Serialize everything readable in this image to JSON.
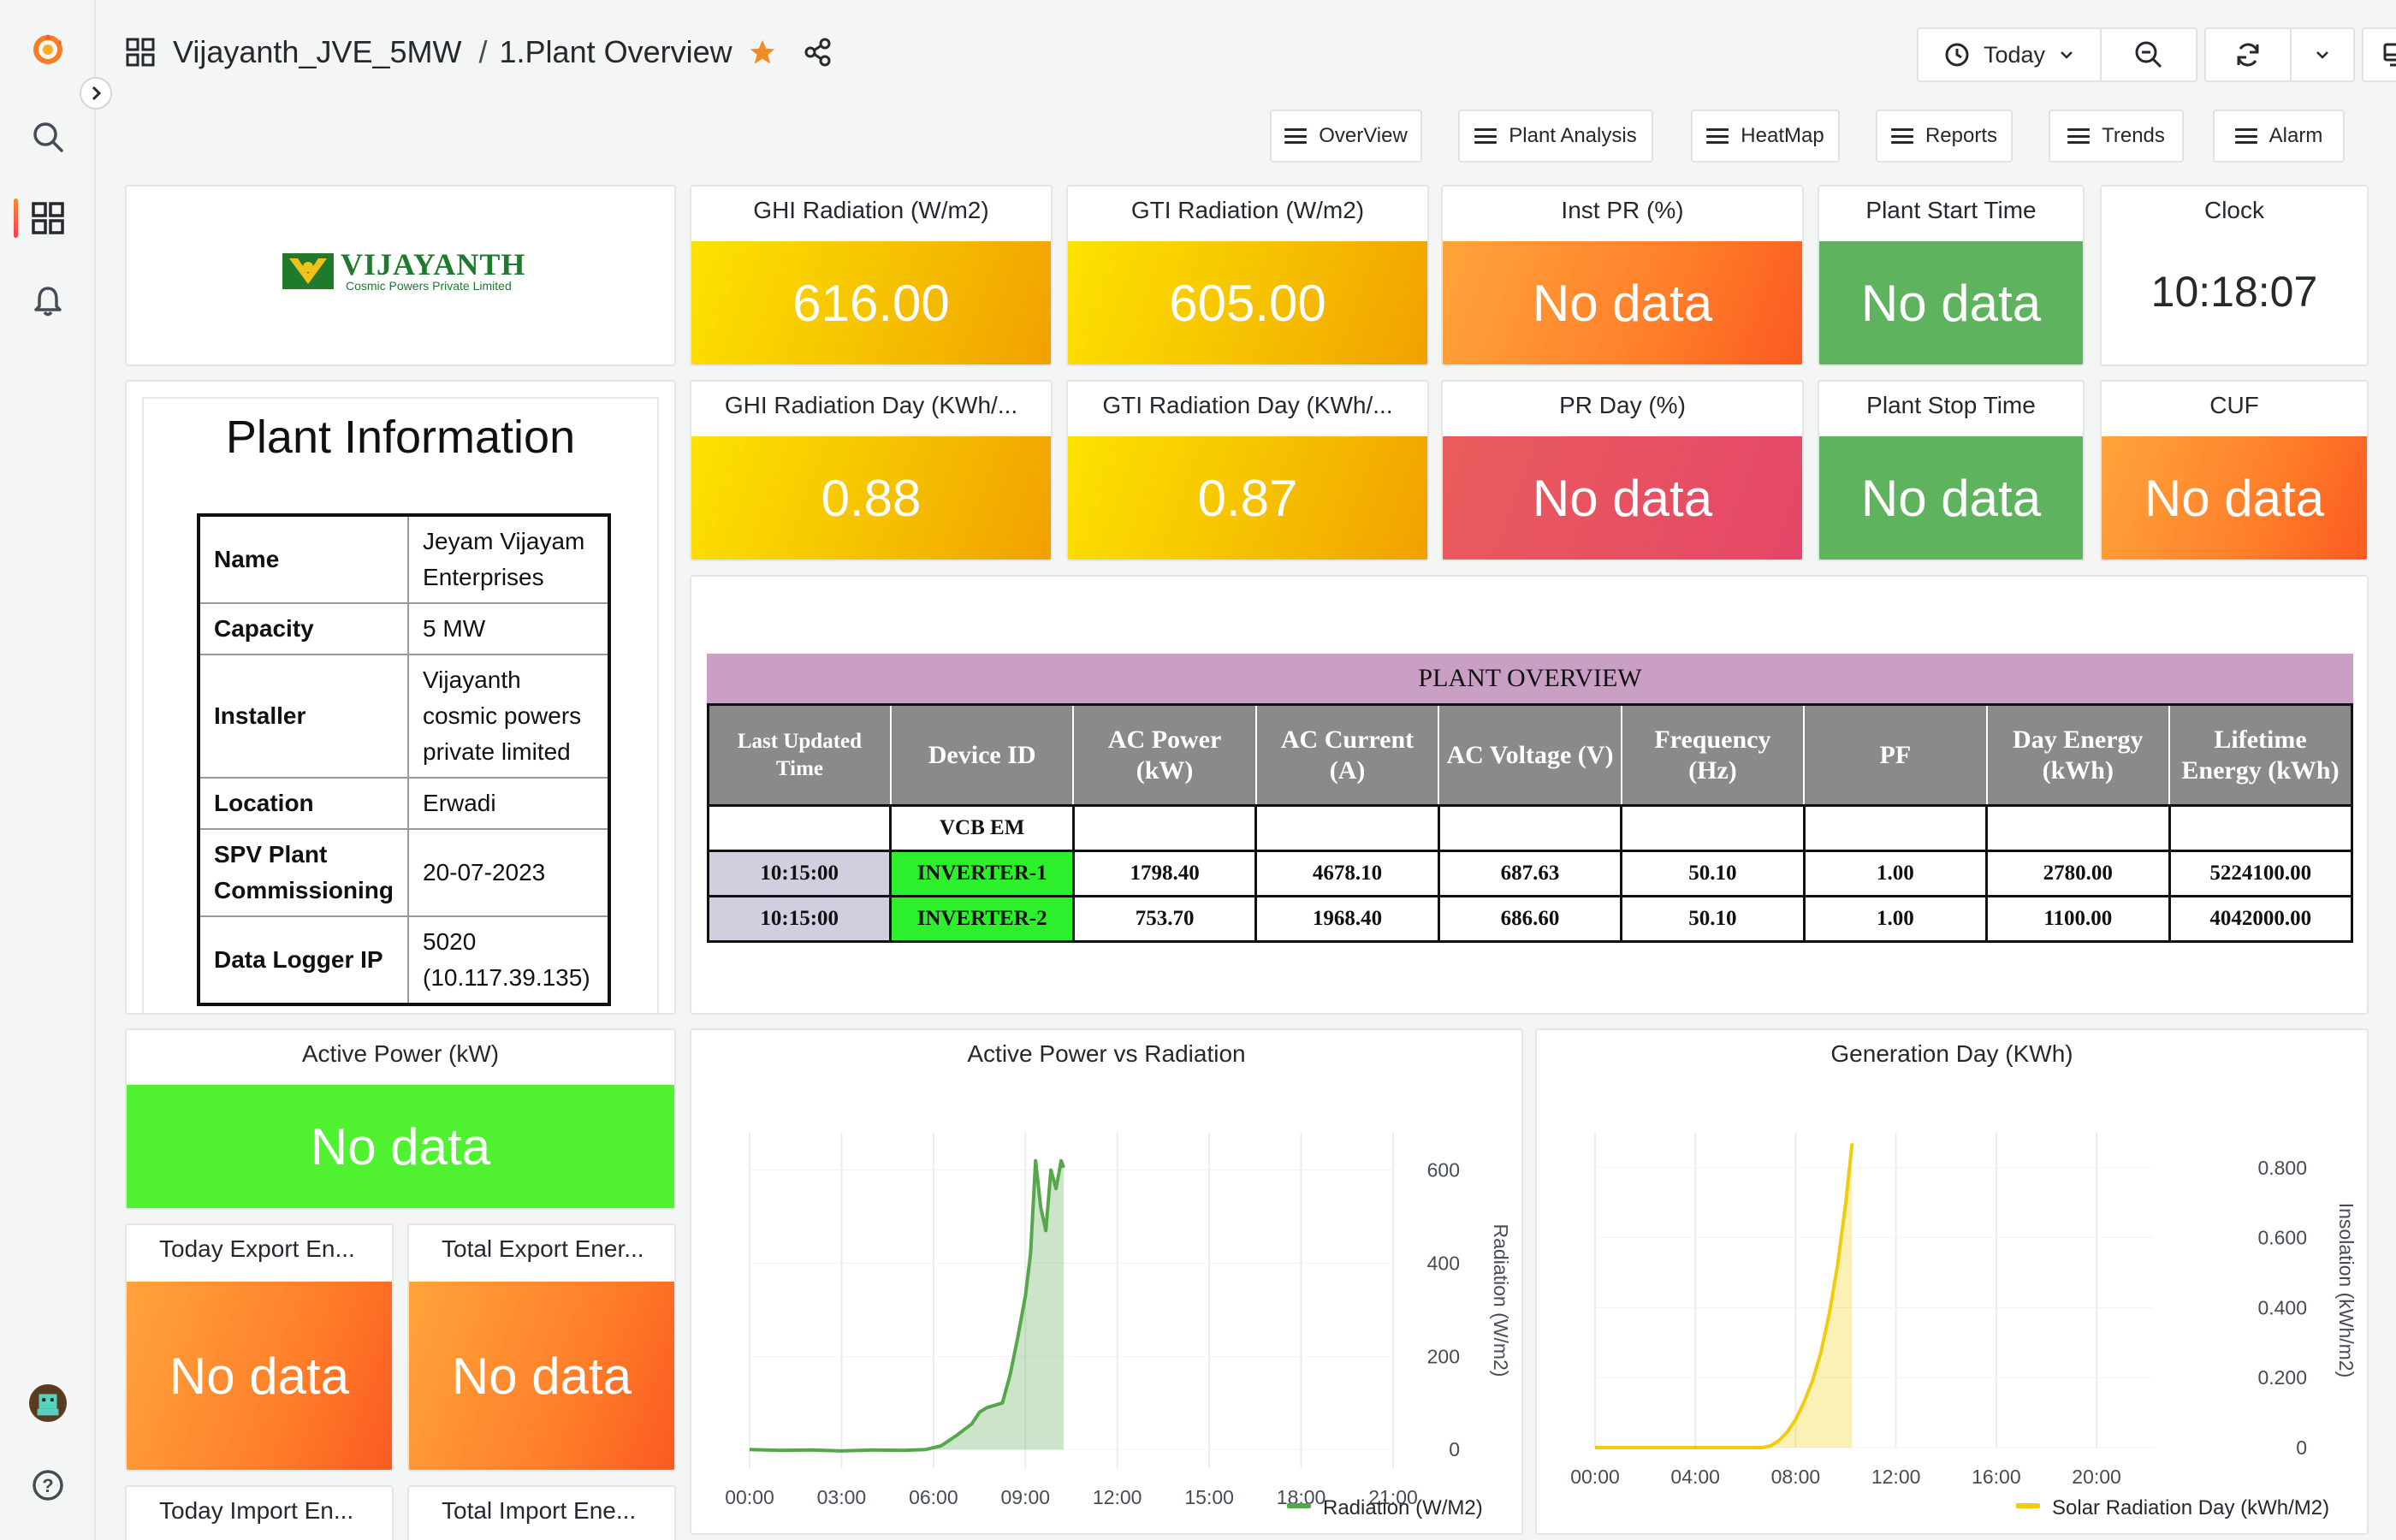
{
  "breadcrumb": {
    "folder": "Vijayanth_JVE_5MW",
    "separator": "/",
    "dashboard": "1.Plant Overview"
  },
  "time_picker": {
    "label": "Today"
  },
  "nav": [
    "OverView",
    "Plant Analysis",
    "HeatMap",
    "Reports",
    "Trends",
    "Alarm"
  ],
  "logo": {
    "name": "VIJAYANTH",
    "sub": "Cosmic Powers Private Limited"
  },
  "stats_row1": [
    {
      "title": "GHI Radiation (W/m2)",
      "value": "616.00",
      "color": "#f5c000"
    },
    {
      "title": "GTI Radiation (W/m2)",
      "value": "605.00",
      "color": "#f5c000"
    },
    {
      "title": "Inst PR (%)",
      "value": "No data",
      "color": "#ff7f2a"
    },
    {
      "title": "Plant Start Time",
      "value": "No data",
      "color": "#5fb35f"
    }
  ],
  "clock": {
    "title": "Clock",
    "value": "10:18:07"
  },
  "stats_row2": [
    {
      "title": "GHI Radiation Day (KWh/...",
      "value": "0.88",
      "color": "#f5c000"
    },
    {
      "title": "GTI Radiation Day (KWh/...",
      "value": "0.87",
      "color": "#f5c000"
    },
    {
      "title": "PR Day (%)",
      "value": "No data",
      "color": "#e44768"
    },
    {
      "title": "Plant Stop Time",
      "value": "No data",
      "color": "#5fb35f"
    },
    {
      "title": "CUF",
      "value": "No data",
      "color": "#ff7f2a"
    }
  ],
  "plant_info": {
    "title": "Plant Information",
    "rows": [
      {
        "k": "Name",
        "v": "Jeyam Vijayam Enterprises"
      },
      {
        "k": "Capacity",
        "v": "5 MW"
      },
      {
        "k": "Installer",
        "v": "Vijayanth cosmic powers private limited"
      },
      {
        "k": "Location",
        "v": "Erwadi"
      },
      {
        "k": "SPV Plant Commissioning",
        "v": "20-07-2023"
      },
      {
        "k": "Data Logger IP",
        "v": "5020 (10.117.39.135)"
      }
    ]
  },
  "plant_overview": {
    "title": "PLANT OVERVIEW",
    "headers": [
      "Last Updated Time",
      "Device ID",
      "AC Power (kW)",
      "AC Current (A)",
      "AC Voltage (V)",
      "Frequency (Hz)",
      "PF",
      "Day Energy (kWh)",
      "Lifetime Energy (kWh)"
    ],
    "group_label": "VCB EM",
    "rows": [
      [
        "10:15:00",
        "INVERTER-1",
        "1798.40",
        "4678.10",
        "687.63",
        "50.10",
        "1.00",
        "2780.00",
        "5224100.00"
      ],
      [
        "10:15:00",
        "INVERTER-2",
        "753.70",
        "1968.40",
        "686.60",
        "50.10",
        "1.00",
        "1100.00",
        "4042000.00"
      ]
    ]
  },
  "active_power": {
    "title": "Active Power (kW)",
    "value": "No data",
    "color": "#4ff131"
  },
  "energy_tiles": [
    {
      "title": "Today Export En...",
      "value": "No data",
      "color": "#ff7f2a"
    },
    {
      "title": "Total Export Ener...",
      "value": "No data",
      "color": "#ff7f2a"
    }
  ],
  "energy_tiles2": [
    {
      "title": "Today Import En..."
    },
    {
      "title": "Total Import Ene..."
    }
  ],
  "chart_data": [
    {
      "type": "area",
      "title": "Active Power vs Radiation",
      "x_ticks": [
        "00:00",
        "03:00",
        "06:00",
        "09:00",
        "12:00",
        "15:00",
        "18:00",
        "21:00"
      ],
      "y_ticks": [
        0,
        200,
        400,
        600
      ],
      "ylabel": "Radiation (W/m2)",
      "ylim": [
        -40,
        680
      ],
      "series": [
        {
          "name": "Radiation (W/M2)",
          "color": "#56a64b",
          "x": [
            "00:00",
            "01:00",
            "02:00",
            "03:00",
            "04:00",
            "05:00",
            "05:45",
            "06:15",
            "06:45",
            "07:15",
            "07:30",
            "07:45",
            "08:00",
            "08:15",
            "08:30",
            "08:45",
            "09:00",
            "09:10",
            "09:20",
            "09:30",
            "09:40",
            "09:50",
            "10:00",
            "10:10",
            "10:15"
          ],
          "values": [
            0,
            -2,
            -1,
            -3,
            -1,
            -2,
            0,
            8,
            30,
            55,
            80,
            90,
            95,
            100,
            160,
            240,
            330,
            420,
            620,
            520,
            470,
            600,
            560,
            620,
            605
          ]
        }
      ]
    },
    {
      "type": "area",
      "title": "Generation Day (KWh)",
      "x_ticks": [
        "00:00",
        "04:00",
        "08:00",
        "12:00",
        "16:00",
        "20:00"
      ],
      "y_ticks": [
        "0",
        "0.200",
        "0.400",
        "0.600",
        "0.800"
      ],
      "ylabel": "Insolation (kWh/m2)",
      "ylim": [
        0,
        0.9
      ],
      "series": [
        {
          "name": "Solar Radiation Day (kWh/M2)",
          "color": "#f2cc0c",
          "x": [
            "00:00",
            "02:00",
            "04:00",
            "06:00",
            "06:40",
            "07:00",
            "07:20",
            "07:40",
            "08:00",
            "08:20",
            "08:40",
            "09:00",
            "09:20",
            "09:40",
            "10:00",
            "10:15"
          ],
          "values": [
            0,
            0,
            0,
            0,
            0,
            0.005,
            0.02,
            0.045,
            0.08,
            0.13,
            0.19,
            0.27,
            0.38,
            0.52,
            0.7,
            0.87
          ]
        }
      ]
    }
  ]
}
